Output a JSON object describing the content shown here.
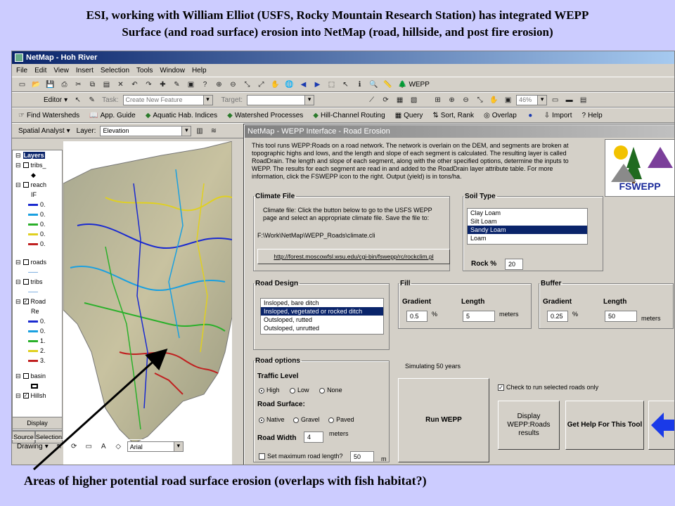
{
  "slide": {
    "title_line1": "ESI, working with William Elliot (USFS, Rocky Mountain Research Station) has integrated WEPP",
    "title_line2": "Surface (and road surface) erosion into NetMap (road, hillside, and post fire erosion)",
    "caption": "Areas of higher potential road surface erosion (overlaps with fish habitat?)"
  },
  "app": {
    "title": "NetMap - Hoh River",
    "menu": [
      "File",
      "Edit",
      "View",
      "Insert",
      "Selection",
      "Tools",
      "Window",
      "Help"
    ],
    "wepp_button": "WEPP",
    "editor_label": "Editor",
    "task_label": "Task:",
    "task_value": "Create New Feature",
    "target_label": "Target:",
    "zoom_value": "46%",
    "netmap_toolbar": [
      "Find Watersheds",
      "App. Guide",
      "Aquatic Hab. Indices",
      "Watershed Processes",
      "Hill-Channel Routing",
      "Query",
      "Sort, Rank",
      "Overlap",
      "Import",
      "Help"
    ],
    "spatial_analyst": "Spatial Analyst",
    "layer_label": "Layer:",
    "layer_value": "Elevation",
    "toc": {
      "layers_root": "Layers",
      "items": [
        "tribs_",
        "reach",
        "IF",
        "0.",
        "0.",
        "0.",
        "0.",
        "0.",
        "roads",
        "tribs",
        "Road",
        "Re",
        "0.",
        "0.",
        "1.",
        "2.",
        "3.",
        "basin",
        "Hillsh"
      ],
      "tab_display": "Display",
      "tab_source": "Source",
      "tab_selection": "Selection"
    },
    "drawing_label": "Drawing",
    "font_value": "Arial"
  },
  "dialog": {
    "title": "NetMap - WEPP Interface - Road Erosion",
    "description": "This tool runs WEPP:Roads on a road network.  The network is overlain on the DEM, and segments are broken at topographic highs and lows, and the length and slope of each segment is calculated.  The resulting layer is called RoadDrain.  The length and slope of each segment, along with the other specified options, determine the inputs to WEPP.  The results for each segment are read in and added to the RoadDrain layer attribute table.  For more information, click the FSWEPP icon to the right.  Output (yield) is in tons/ha.",
    "logo_text": "FSWEPP",
    "climate": {
      "legend": "Climate File",
      "instructions": "Climate file:  Click the button below to go to the USFS WEPP page and select an appropriate climate file.  Save the file to:",
      "path": "F:\\Work\\NetMap\\WEPP_Roads\\climate.cli",
      "url_button": "http://forest.moscowfsl.wsu.edu/cgi-bin/fswepp/rc/rockclim.pl"
    },
    "soil": {
      "legend": "Soil Type",
      "options": [
        "Clay Loam",
        "Silt Loam",
        "Sandy Loam",
        "Loam"
      ],
      "selected_index": 2,
      "rock_label": "Rock %",
      "rock_value": "20"
    },
    "road_design": {
      "legend": "Road Design",
      "options": [
        "Insloped, bare ditch",
        "Insloped, vegetated or rocked ditch",
        "Outsloped, rutted",
        "Outsloped, unrutted"
      ],
      "selected_index": 1
    },
    "fill": {
      "legend": "Fill",
      "gradient_label": "Gradient",
      "length_label": "Length",
      "gradient_value": "0.5",
      "gradient_unit": "%",
      "length_value": "5",
      "length_unit": "meters"
    },
    "buffer": {
      "legend": "Buffer",
      "gradient_label": "Gradient",
      "length_label": "Length",
      "gradient_value": "0.25",
      "gradient_unit": "%",
      "length_value": "50",
      "length_unit": "meters"
    },
    "road_options": {
      "legend": "Road options",
      "traffic_label": "Traffic Level",
      "traffic": [
        "High",
        "Low",
        "None"
      ],
      "surface_label": "Road Surface:",
      "surface": [
        "Native",
        "Gravel",
        "Paved"
      ],
      "width_label": "Road Width",
      "width_value": "4",
      "width_unit": "meters",
      "maxlen_label": "Set maximum road length?",
      "maxlen_value": "50",
      "maxlen_unit": "m"
    },
    "simulating": "Simulating 50 years",
    "selected_only": "Check to run selected roads only",
    "run_button": "Run WEPP",
    "display_button": "Display WEPP:Roads results",
    "help_button": "Get Help For This Tool"
  }
}
